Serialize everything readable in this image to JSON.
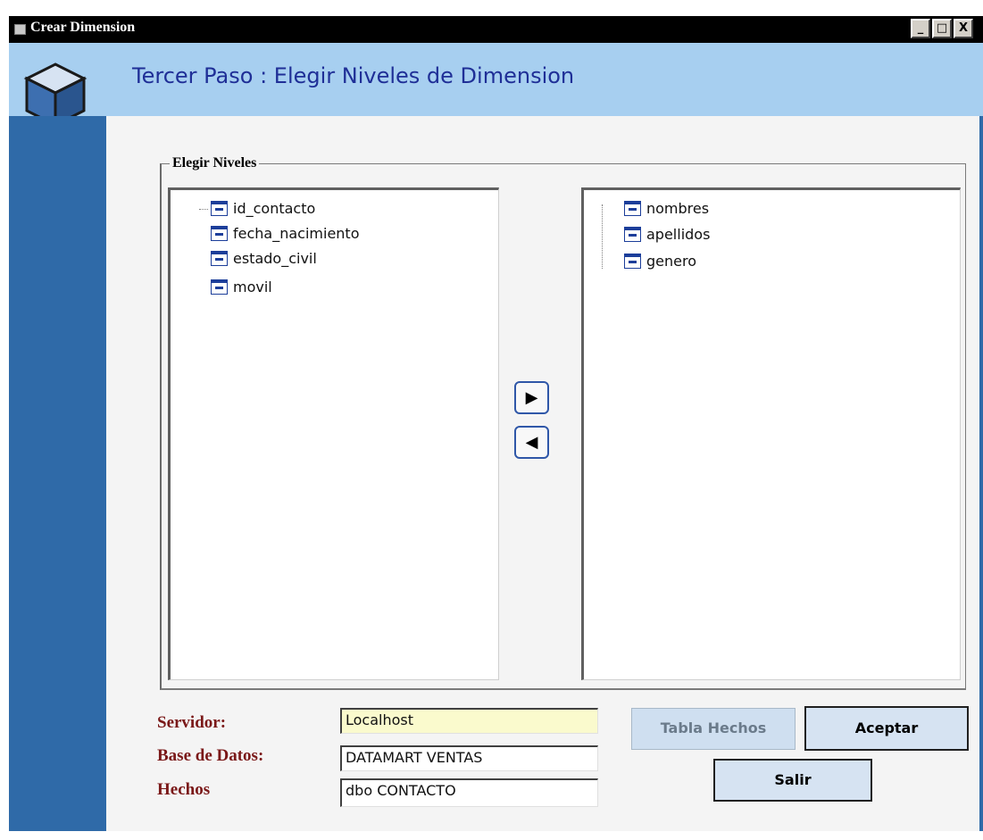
{
  "window": {
    "title": "Crear Dimension",
    "controls": {
      "minimize": "_",
      "maximize": "□",
      "close": "X"
    }
  },
  "header": {
    "step_title": "Tercer Paso :  Elegir Niveles de Dimension",
    "icon": "cube-icon"
  },
  "group": {
    "legend": "Elegir Niveles"
  },
  "available_list": {
    "items": [
      {
        "label": "id_contacto",
        "icon": "field-icon"
      },
      {
        "label": "fecha_nacimiento",
        "icon": "field-icon"
      },
      {
        "label": "estado_civil",
        "icon": "field-icon"
      },
      {
        "label": "movil",
        "icon": "field-icon"
      }
    ]
  },
  "selected_list": {
    "items": [
      {
        "label": "nombres",
        "icon": "field-icon"
      },
      {
        "label": "apellidos",
        "icon": "field-icon"
      },
      {
        "label": "genero",
        "icon": "field-icon"
      }
    ]
  },
  "move_buttons": {
    "right": "▶",
    "left": "◀"
  },
  "fields": {
    "servidor": {
      "label": "Servidor:",
      "value": "Localhost"
    },
    "base_datos": {
      "label": "Base de Datos:",
      "value": "DATAMART VENTAS"
    },
    "hechos": {
      "label": "Hechos",
      "value": "dbo CONTACTO"
    }
  },
  "buttons": {
    "tabla_hechos": "Tabla Hechos",
    "aceptar": "Aceptar",
    "salir": "Salir"
  },
  "colors": {
    "header_bg": "#a7cff0",
    "sidebar_bg": "#2f6aa8",
    "title_text": "#1f2f97",
    "label_text": "#7a1818",
    "servidor_field_bg": "#fafacd"
  }
}
